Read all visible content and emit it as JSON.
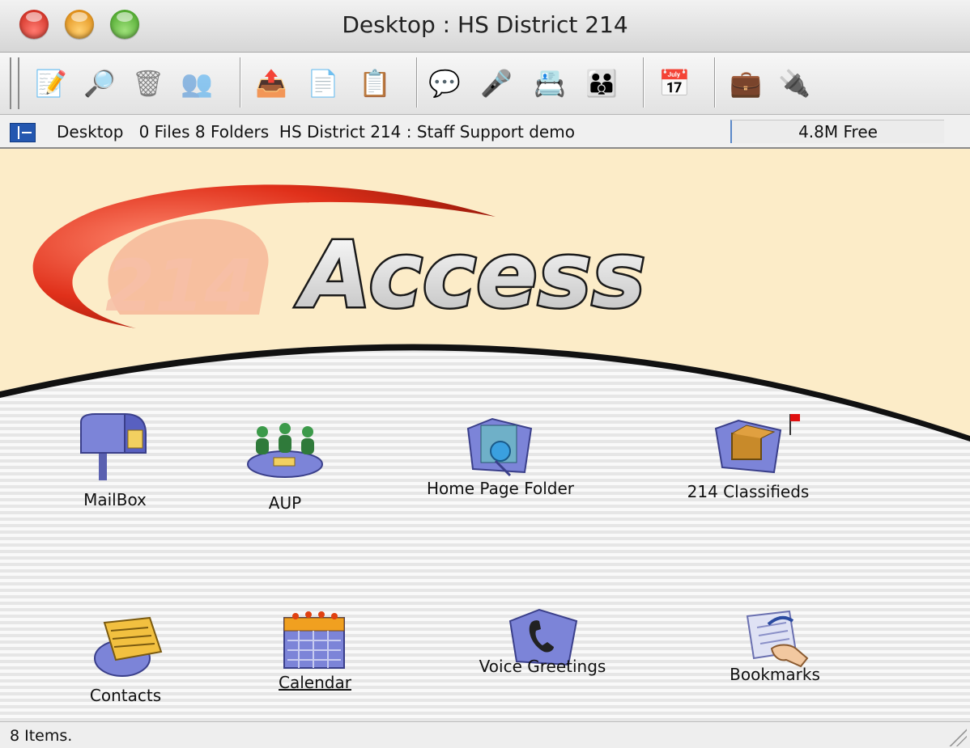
{
  "window": {
    "title": "Desktop : HS District 214"
  },
  "toolbar": {
    "buttons": [
      {
        "name": "new-message",
        "icon": "compose-icon",
        "glyph": "📝"
      },
      {
        "name": "find",
        "icon": "magnifier-icon",
        "glyph": "🔎"
      },
      {
        "name": "trash",
        "icon": "trash-icon",
        "glyph": "🗑"
      },
      {
        "name": "who-is-online",
        "icon": "people-query-icon",
        "glyph": "👥"
      },
      {
        "name": "upload",
        "icon": "upload-document-icon",
        "glyph": "📤"
      },
      {
        "name": "send-file",
        "icon": "send-document-icon",
        "glyph": "📄"
      },
      {
        "name": "properties",
        "icon": "info-document-icon",
        "glyph": "📋"
      },
      {
        "name": "chat",
        "icon": "chat-icon",
        "glyph": "💬"
      },
      {
        "name": "conference",
        "icon": "podium-icon",
        "glyph": "🎤"
      },
      {
        "name": "user-list",
        "icon": "directory-icon",
        "glyph": "📇"
      },
      {
        "name": "groups",
        "icon": "groups-icon",
        "glyph": "👪"
      },
      {
        "name": "calendar",
        "icon": "calendar-icon",
        "glyph": "📅"
      },
      {
        "name": "briefcase",
        "icon": "briefcase-icon",
        "glyph": "💼"
      },
      {
        "name": "disconnect",
        "icon": "disconnect-icon",
        "glyph": "🔌"
      }
    ]
  },
  "pathbar": {
    "location": "Desktop",
    "files": "0 Files",
    "folders": "8 Folders",
    "server": "HS District 214",
    "separator": ":",
    "account": "Staff Support demo",
    "free": "4.8M Free"
  },
  "banner": {
    "logo_number": "214",
    "logo_word": "Access"
  },
  "items": [
    {
      "name": "mailbox",
      "label": "MailBox",
      "icon": "mailbox-icon",
      "underlined": false
    },
    {
      "name": "aup",
      "label": "AUP",
      "icon": "conference-table-icon",
      "underlined": false
    },
    {
      "name": "home-page-folder",
      "label": "Home Page Folder",
      "icon": "web-folder-icon",
      "underlined": false
    },
    {
      "name": "214-classifieds",
      "label": "214 Classifieds",
      "icon": "package-folder-icon",
      "underlined": false,
      "flagged": true
    },
    {
      "name": "contacts",
      "label": "Contacts",
      "icon": "rolodex-icon",
      "underlined": false
    },
    {
      "name": "calendar",
      "label": "Calendar",
      "icon": "calendar-icon",
      "underlined": true
    },
    {
      "name": "voice-greetings",
      "label": "Voice Greetings",
      "icon": "phone-folder-icon",
      "underlined": false
    },
    {
      "name": "bookmarks",
      "label": "Bookmarks",
      "icon": "bookmark-hand-icon",
      "underlined": false
    }
  ],
  "status": {
    "text": "8 Items."
  }
}
